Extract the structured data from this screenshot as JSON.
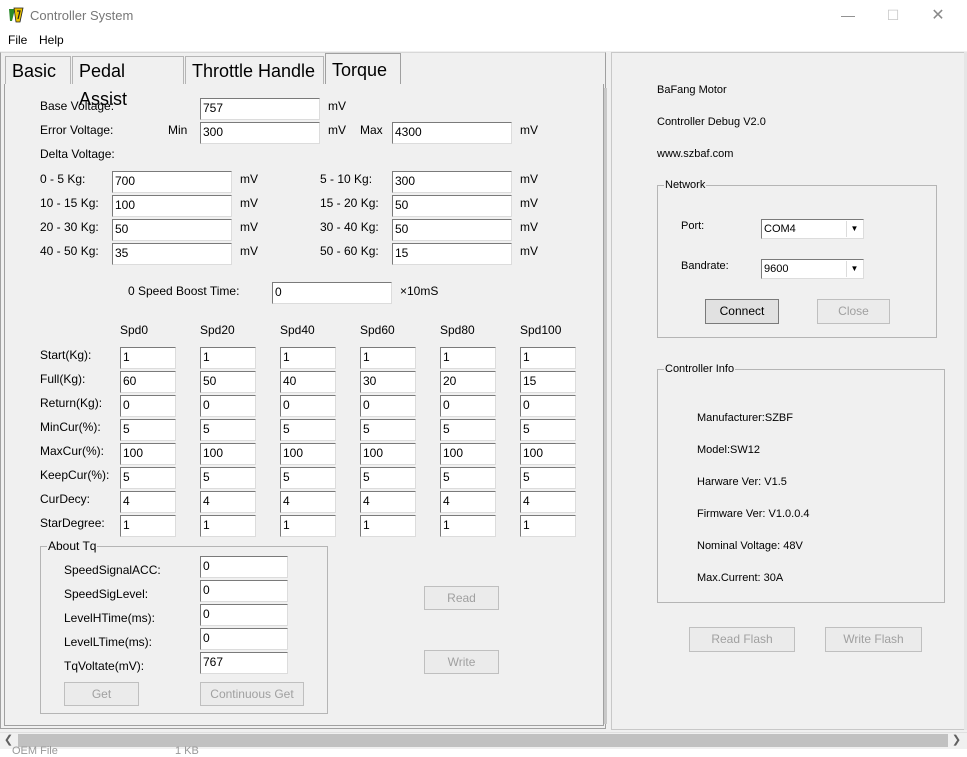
{
  "window": {
    "title": "Controller System",
    "min": "—",
    "max": "☐",
    "close": "✕"
  },
  "menu": {
    "file": "File",
    "help": "Help"
  },
  "tabs": {
    "basic": "Basic",
    "pedal": "Pedal Assist",
    "throttle": "Throttle Handle",
    "torque": "Torque"
  },
  "torque": {
    "base_voltage": {
      "label": "Base Voltage:",
      "value": "757",
      "unit": "mV"
    },
    "error_voltage": {
      "label": "Error Voltage:",
      "min_label": "Min",
      "min_value": "300",
      "min_unit": "mV",
      "max_label": "Max",
      "max_value": "4300",
      "max_unit": "mV"
    },
    "delta_voltage_label": "Delta Voltage:",
    "delta": [
      {
        "label": "0 - 5 Kg:",
        "value": "700",
        "unit": "mV"
      },
      {
        "label": "10 - 15 Kg:",
        "value": "100",
        "unit": "mV"
      },
      {
        "label": "20 - 30 Kg:",
        "value": "50",
        "unit": "mV"
      },
      {
        "label": "40 - 50 Kg:",
        "value": "35",
        "unit": "mV"
      },
      {
        "label": "5 - 10 Kg:",
        "value": "300",
        "unit": "mV"
      },
      {
        "label": "15 - 20 Kg:",
        "value": "50",
        "unit": "mV"
      },
      {
        "label": "30 - 40 Kg:",
        "value": "50",
        "unit": "mV"
      },
      {
        "label": "50 - 60 Kg:",
        "value": "15",
        "unit": "mV"
      }
    ],
    "boost": {
      "label": "0 Speed Boost Time:",
      "value": "0",
      "unit": "×10mS"
    },
    "grid": {
      "columns": [
        "Spd0",
        "Spd20",
        "Spd40",
        "Spd60",
        "Spd80",
        "Spd100"
      ],
      "rows": [
        {
          "label": "Start(Kg):",
          "values": [
            "1",
            "1",
            "1",
            "1",
            "1",
            "1"
          ]
        },
        {
          "label": "Full(Kg):",
          "values": [
            "60",
            "50",
            "40",
            "30",
            "20",
            "15"
          ]
        },
        {
          "label": "Return(Kg):",
          "values": [
            "0",
            "0",
            "0",
            "0",
            "0",
            "0"
          ]
        },
        {
          "label": "MinCur(%):",
          "values": [
            "5",
            "5",
            "5",
            "5",
            "5",
            "5"
          ]
        },
        {
          "label": "MaxCur(%):",
          "values": [
            "100",
            "100",
            "100",
            "100",
            "100",
            "100"
          ]
        },
        {
          "label": "KeepCur(%):",
          "values": [
            "5",
            "5",
            "5",
            "5",
            "5",
            "5"
          ]
        },
        {
          "label": "CurDecy:",
          "values": [
            "4",
            "4",
            "4",
            "4",
            "4",
            "4"
          ]
        },
        {
          "label": "StarDegree:",
          "values": [
            "1",
            "1",
            "1",
            "1",
            "1",
            "1"
          ]
        }
      ]
    },
    "about": {
      "title": "About Tq",
      "fields": [
        {
          "label": "SpeedSignalACC:",
          "value": "0"
        },
        {
          "label": "SpeedSigLevel:",
          "value": "0"
        },
        {
          "label": "LevelHTime(ms):",
          "value": "0"
        },
        {
          "label": "LevelLTime(ms):",
          "value": "0"
        },
        {
          "label": "TqVoltate(mV):",
          "value": "767"
        }
      ],
      "get": "Get",
      "continuous_get": "Continuous Get"
    },
    "read": "Read",
    "write": "Write"
  },
  "info": {
    "brand": "BaFang Motor",
    "version": "Controller Debug V2.0",
    "site": "www.szbaf.com"
  },
  "network": {
    "title": "Network",
    "port_label": "Port:",
    "port_value": "COM4",
    "baud_label": "Bandrate:",
    "baud_value": "9600",
    "connect": "Connect",
    "close": "Close"
  },
  "controller_info": {
    "title": "Controller Info",
    "lines": [
      "Manufacturer:SZBF",
      "Model:SW12",
      "Harware Ver: V1.5",
      "Firmware Ver: V1.0.0.4",
      "Nominal Voltage: 48V",
      "Max.Current: 30A"
    ]
  },
  "flash": {
    "read": "Read Flash",
    "write": "Write Flash"
  },
  "background": {
    "file_name": "OEM File",
    "file_size": "1 KB"
  },
  "colors": {
    "icon_yellow": "#e8c000",
    "icon_green": "#2a8a2a"
  }
}
